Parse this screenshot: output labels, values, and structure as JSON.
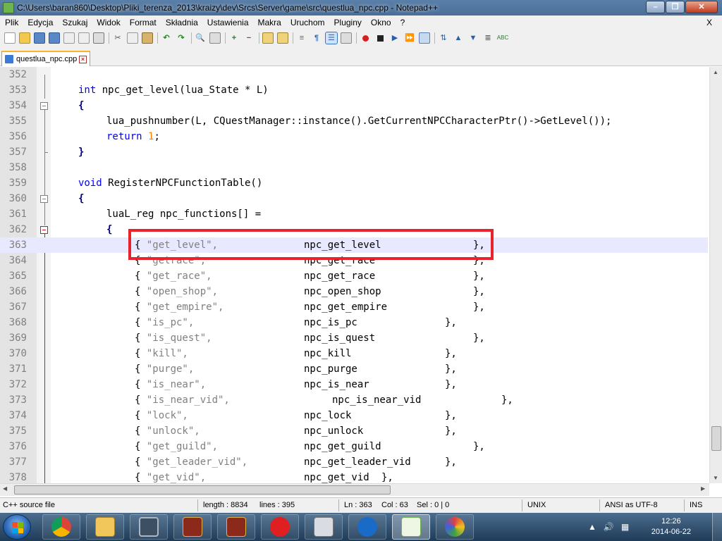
{
  "window": {
    "title": "C:\\Users\\baran860\\Desktop\\Pliki_terenza_2013\\kraizy\\dev\\Srcs\\Server\\game\\src\\questlua_npc.cpp - Notepad++"
  },
  "menu": {
    "items": [
      "Plik",
      "Edycja",
      "Szukaj",
      "Widok",
      "Format",
      "Składnia",
      "Ustawienia",
      "Makra",
      "Uruchom",
      "Pluginy",
      "Okno",
      "?"
    ],
    "close": "X"
  },
  "tab": {
    "label": "questlua_npc.cpp"
  },
  "editor": {
    "lines": [
      {
        "n": "352"
      },
      {
        "n": "353"
      },
      {
        "n": "354"
      },
      {
        "n": "355"
      },
      {
        "n": "356"
      },
      {
        "n": "357"
      },
      {
        "n": "358"
      },
      {
        "n": "359"
      },
      {
        "n": "360"
      },
      {
        "n": "361"
      },
      {
        "n": "362"
      },
      {
        "n": "363"
      },
      {
        "n": "364"
      },
      {
        "n": "365"
      },
      {
        "n": "366"
      },
      {
        "n": "367"
      },
      {
        "n": "368"
      },
      {
        "n": "369"
      },
      {
        "n": "370"
      },
      {
        "n": "371"
      },
      {
        "n": "372"
      },
      {
        "n": "373"
      },
      {
        "n": "374"
      },
      {
        "n": "375"
      },
      {
        "n": "376"
      },
      {
        "n": "377"
      },
      {
        "n": "378"
      }
    ],
    "code": {
      "l353_kw": "int",
      "l353_rest": " npc_get_level(lua_State * L)",
      "l354": "{",
      "l355_a": "lua_pushnumber(L, CQuestManager::instance().GetCurrentNPCCharacterPtr()->GetLevel());",
      "l356_kw": "return",
      "l356_num": "1",
      "l356_end": ";",
      "l357": "}",
      "l359_kw": "void",
      "l359_rest": " RegisterNPCFunctionTable()",
      "l360": "{",
      "l361": "luaL_reg npc_functions[] =",
      "l362": "{",
      "entries": [
        {
          "s": "\"get_level\",",
          "f": "npc_get_level",
          "e": "},"
        },
        {
          "s": "\"getrace\",",
          "f": "npc_get_race",
          "e": "},"
        },
        {
          "s": "\"get_race\",",
          "f": "npc_get_race",
          "e": "},"
        },
        {
          "s": "\"open_shop\",",
          "f": "npc_open_shop",
          "e": "},"
        },
        {
          "s": "\"get_empire\",",
          "f": "npc_get_empire",
          "e": "},"
        },
        {
          "s": "\"is_pc\",",
          "f": "npc_is_pc",
          "e": "},"
        },
        {
          "s": "\"is_quest\",",
          "f": "npc_is_quest",
          "e": "},"
        },
        {
          "s": "\"kill\",",
          "f": "npc_kill",
          "e": "},"
        },
        {
          "s": "\"purge\",",
          "f": "npc_purge",
          "e": "},"
        },
        {
          "s": "\"is_near\",",
          "f": "npc_is_near",
          "e": "},"
        },
        {
          "s": "\"is_near_vid\",",
          "f": "npc_is_near_vid",
          "e": "},"
        },
        {
          "s": "\"lock\",",
          "f": "npc_lock",
          "e": "},"
        },
        {
          "s": "\"unlock\",",
          "f": "npc_unlock",
          "e": "},"
        },
        {
          "s": "\"get_guild\",",
          "f": "npc_get_guild",
          "e": "},"
        },
        {
          "s": "\"get_leader_vid\",",
          "f": "npc_get_leader_vid",
          "e": "},"
        },
        {
          "s": "\"get_vid\",",
          "f": "npc_get_vid",
          "e": "},"
        }
      ]
    }
  },
  "statusbar": {
    "lang": "C++ source file",
    "length": "length : 8834",
    "lines": "lines : 395",
    "ln": "Ln : 363",
    "col": "Col : 63",
    "sel": "Sel : 0 | 0",
    "eol": "UNIX",
    "encoding": "ANSI as UTF-8",
    "mode": "INS"
  },
  "taskbar": {
    "clock_time": "12:26",
    "clock_date": "2014-06-22"
  },
  "colors": {
    "keyword": "#0000ff",
    "string": "#808080",
    "number": "#ff8000",
    "highlight_box": "#e8232b",
    "current_line": "#e8e8ff"
  }
}
